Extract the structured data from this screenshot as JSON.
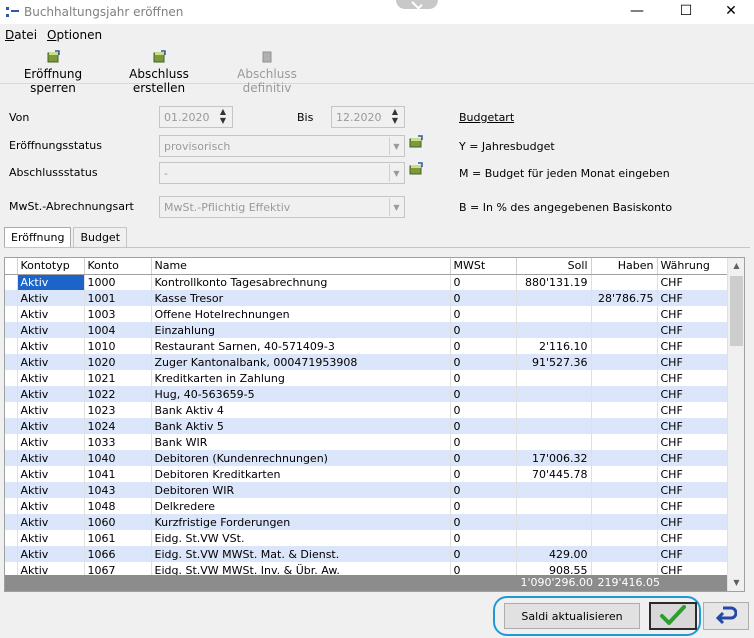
{
  "window": {
    "title": "Buchhaltungsjahr eröffnen",
    "minimize": "—",
    "maximize": "☐",
    "close": "✕"
  },
  "menu": [
    "Datei",
    "Optionen"
  ],
  "toolbar": {
    "open_lock": "Eröffnung sperren",
    "create_close": "Abschluss erstellen",
    "final_close": "Abschluss definitiv"
  },
  "form": {
    "von_label": "Von",
    "von_value": "01.2020",
    "bis_label": "Bis",
    "bis_value": "12.2020",
    "eroeffnung_label": "Eröffnungsstatus",
    "eroeffnung_value": "provisorisch",
    "abschluss_label": "Abschlussstatus",
    "abschluss_value": "-",
    "mwst_label": "MwSt.-Abrechnungsart",
    "mwst_value": "MwSt.-Pflichtig Effektiv"
  },
  "budget": {
    "title": "Budgetart",
    "y": "Y = Jahresbudget",
    "m": "M = Budget für jeden Monat eingeben",
    "b": "B = In % des angegebenen Basiskonto"
  },
  "tabs": [
    "Eröffnung",
    "Budget"
  ],
  "grid": {
    "headers": [
      "Kontotyp",
      "Konto",
      "Name",
      "MWSt",
      "Soll",
      "Haben",
      "Währung"
    ],
    "rows": [
      {
        "typ": "Aktiv",
        "konto": "1000",
        "name": "Kontrollkonto Tagesabrechnung",
        "mwst": "0",
        "soll": "880'131.19",
        "haben": "",
        "cur": "CHF"
      },
      {
        "typ": "Aktiv",
        "konto": "1001",
        "name": "Kasse Tresor",
        "mwst": "0",
        "soll": "",
        "haben": "28'786.75",
        "cur": "CHF"
      },
      {
        "typ": "Aktiv",
        "konto": "1003",
        "name": "Offene Hotelrechnungen",
        "mwst": "0",
        "soll": "",
        "haben": "",
        "cur": "CHF"
      },
      {
        "typ": "Aktiv",
        "konto": "1004",
        "name": "Einzahlung",
        "mwst": "0",
        "soll": "",
        "haben": "",
        "cur": "CHF"
      },
      {
        "typ": "Aktiv",
        "konto": "1010",
        "name": "Restaurant Sarnen, 40-571409-3",
        "mwst": "0",
        "soll": "2'116.10",
        "haben": "",
        "cur": "CHF"
      },
      {
        "typ": "Aktiv",
        "konto": "1020",
        "name": "Zuger Kantonalbank, 000471953908",
        "mwst": "0",
        "soll": "91'527.36",
        "haben": "",
        "cur": "CHF"
      },
      {
        "typ": "Aktiv",
        "konto": "1021",
        "name": "Kreditkarten in Zahlung",
        "mwst": "0",
        "soll": "",
        "haben": "",
        "cur": "CHF"
      },
      {
        "typ": "Aktiv",
        "konto": "1022",
        "name": "Hug, 40-563659-5",
        "mwst": "0",
        "soll": "",
        "haben": "",
        "cur": "CHF"
      },
      {
        "typ": "Aktiv",
        "konto": "1023",
        "name": "Bank Aktiv 4",
        "mwst": "0",
        "soll": "",
        "haben": "",
        "cur": "CHF"
      },
      {
        "typ": "Aktiv",
        "konto": "1024",
        "name": "Bank Aktiv 5",
        "mwst": "0",
        "soll": "",
        "haben": "",
        "cur": "CHF"
      },
      {
        "typ": "Aktiv",
        "konto": "1033",
        "name": "Bank WIR",
        "mwst": "0",
        "soll": "",
        "haben": "",
        "cur": "CHF"
      },
      {
        "typ": "Aktiv",
        "konto": "1040",
        "name": "Debitoren (Kundenrechnungen)",
        "mwst": "0",
        "soll": "17'006.32",
        "haben": "",
        "cur": "CHF"
      },
      {
        "typ": "Aktiv",
        "konto": "1041",
        "name": "Debitoren Kreditkarten",
        "mwst": "0",
        "soll": "70'445.78",
        "haben": "",
        "cur": "CHF"
      },
      {
        "typ": "Aktiv",
        "konto": "1043",
        "name": "Debitoren WIR",
        "mwst": "0",
        "soll": "",
        "haben": "",
        "cur": "CHF"
      },
      {
        "typ": "Aktiv",
        "konto": "1048",
        "name": "Delkredere",
        "mwst": "0",
        "soll": "",
        "haben": "",
        "cur": "CHF"
      },
      {
        "typ": "Aktiv",
        "konto": "1060",
        "name": "Kurzfristige Forderungen",
        "mwst": "0",
        "soll": "",
        "haben": "",
        "cur": "CHF"
      },
      {
        "typ": "Aktiv",
        "konto": "1061",
        "name": "Eidg. St.VW VSt.",
        "mwst": "0",
        "soll": "",
        "haben": "",
        "cur": "CHF"
      },
      {
        "typ": "Aktiv",
        "konto": "1066",
        "name": "Eidg. St.VW MWSt. Mat. & Dienst.",
        "mwst": "0",
        "soll": "429.00",
        "haben": "",
        "cur": "CHF"
      },
      {
        "typ": "Aktiv",
        "konto": "1067",
        "name": "Eidg. St.VW MWSt. Inv. & Übr. Aw.",
        "mwst": "0",
        "soll": "908.55",
        "haben": "",
        "cur": "CHF"
      }
    ],
    "total_soll": "1'090'296.00",
    "total_haben": "219'416.05"
  },
  "buttons": {
    "refresh": "Saldi aktualisieren"
  },
  "colors": {
    "selection": "#1c64c8",
    "alt_row": "#dbe6fb",
    "ok_check": "#2e9e2e",
    "highlight_ring": "#1e9ad6"
  }
}
